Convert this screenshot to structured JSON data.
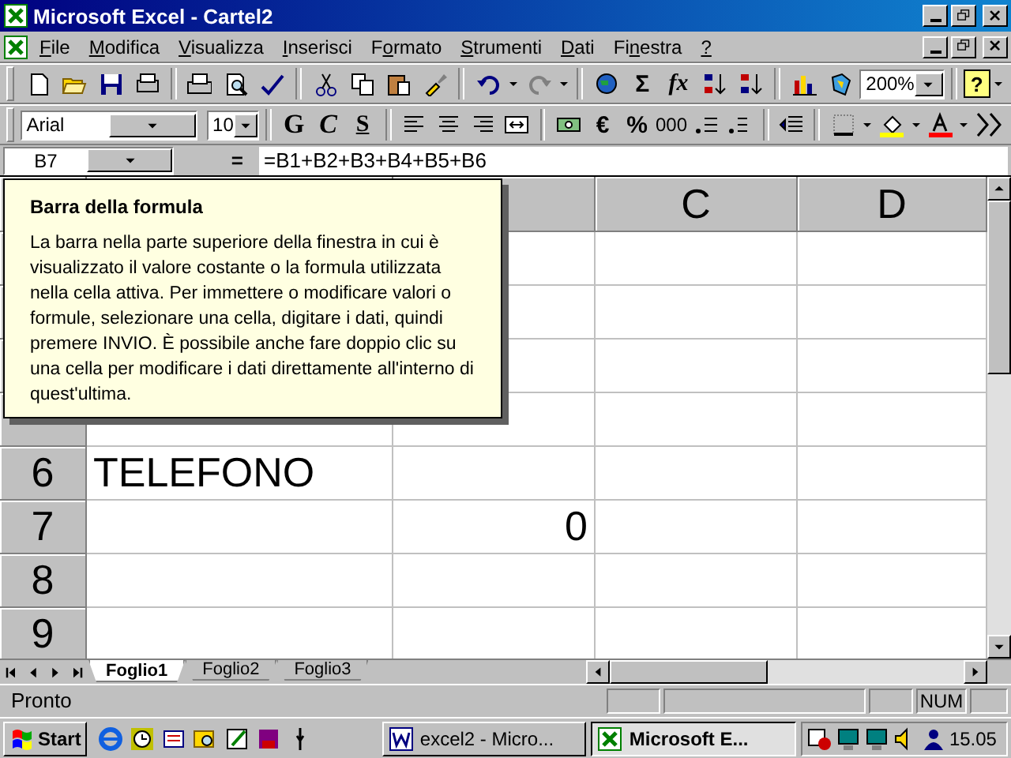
{
  "window": {
    "title": "Microsoft Excel - Cartel2"
  },
  "menu": [
    {
      "key": "F",
      "post": "ile"
    },
    {
      "key": "M",
      "post": "odifica"
    },
    {
      "key": "V",
      "post": "isualizza"
    },
    {
      "key": "I",
      "post": "nserisci"
    },
    {
      "pre": "F",
      "key": "o",
      "post": "rmato"
    },
    {
      "key": "S",
      "post": "trumenti"
    },
    {
      "key": "D",
      "post": "ati"
    },
    {
      "pre": "Fi",
      "key": "n",
      "post": "estra"
    },
    {
      "key": "?"
    }
  ],
  "standard_toolbar": {
    "sum": "Σ",
    "function": "fx",
    "zoom": "200%",
    "help": "?"
  },
  "format_toolbar": {
    "font": "Arial",
    "size": "10",
    "bold": "G",
    "italic": "C",
    "underline": "S",
    "euro": "€",
    "percent": "%",
    "thousands": "000"
  },
  "formula_bar": {
    "name_box": "B7",
    "equals": "=",
    "formula": "=B1+B2+B3+B4+B5+B6"
  },
  "tooltip": {
    "title": "Barra della formula",
    "body": "La barra nella parte superiore della finestra in cui è visualizzato il valore costante o la formula utilizzata nella cella attiva. Per immettere o modificare valori o formule, selezionare una cella, digitare i dati, quindi premere INVIO. È possibile anche fare doppio clic su una cella per modificare i dati direttamente all'interno di quest'ultima."
  },
  "column_headers": {
    "C": "C",
    "D": "D"
  },
  "rows": [
    {
      "header": "6",
      "A": "TELEFONO"
    },
    {
      "header": "7",
      "B": "0"
    },
    {
      "header": "8"
    },
    {
      "header": "9"
    }
  ],
  "sheet_tabs": [
    {
      "label": "Foglio1",
      "selected": true
    },
    {
      "label": "Foglio2",
      "selected": false
    },
    {
      "label": "Foglio3",
      "selected": false
    }
  ],
  "status_bar": {
    "text": "Pronto",
    "indicator": "NUM"
  },
  "taskbar": {
    "start": "Start",
    "tasks": [
      {
        "label": "excel2 - Micro...",
        "kind": "word",
        "selected": false
      },
      {
        "label": "Microsoft E...",
        "kind": "excel",
        "selected": true
      }
    ],
    "clock": "15.05"
  }
}
